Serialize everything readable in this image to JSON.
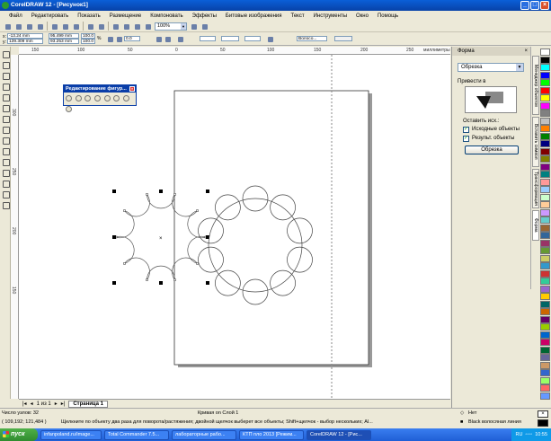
{
  "window": {
    "title": "CorelDRAW 12 - [Рисунок1]"
  },
  "menu": [
    "Файл",
    "Редактировать",
    "Показать",
    "Размещение",
    "Компоновать",
    "Эффекты",
    "Битовые изображения",
    "Текст",
    "Инструменты",
    "Окно",
    "Помощь"
  ],
  "toolbar": {
    "zoom": "100%",
    "line_width": "Волосо..."
  },
  "propbar": {
    "x": "-13.24 mm",
    "y": "139.309 mm",
    "w": "95.499 mm",
    "h": "93.253 mm",
    "sx": "100.0",
    "sy": "100.0",
    "angle": "0.0"
  },
  "rulers": {
    "h_labels": [
      "150",
      "100",
      "50",
      "0",
      "50",
      "100",
      "150",
      "200",
      "250"
    ],
    "h_unit": "миллиметры",
    "v_labels": [
      "300",
      "250",
      "200",
      "150"
    ]
  },
  "float_panel": {
    "title": "Редактирование фигур..."
  },
  "docker": {
    "title": "Форма",
    "mode": "Обрезка",
    "target_label": "Привести в",
    "leave_label": "Оставить исх.:",
    "opt1": "Исходные объекты",
    "opt2": "Результ. объекты",
    "button": "Обрезка"
  },
  "docker_tabs": [
    "Менеджер объектов",
    "Вставить символ",
    "Трансформация",
    "Форма"
  ],
  "palette_colors": [
    "#ffffff",
    "#000000",
    "#00ffff",
    "#0000ff",
    "#00ff00",
    "#ff0000",
    "#ffff00",
    "#ff00ff",
    "#808080",
    "#c0c0c0",
    "#ff8000",
    "#008000",
    "#000080",
    "#800000",
    "#808000",
    "#800080",
    "#008080",
    "#ff9999",
    "#99ccff",
    "#ccffcc",
    "#ffcc99",
    "#cc99ff",
    "#66cccc",
    "#996633",
    "#336699",
    "#993366",
    "#669933",
    "#cccc66",
    "#3399cc",
    "#cc3333",
    "#33cc99",
    "#9966cc",
    "#ffcc00",
    "#006666",
    "#cc6600",
    "#660066",
    "#99cc00",
    "#0066cc",
    "#cc0066",
    "#006633",
    "#666699",
    "#cc9966",
    "#3366cc",
    "#99ff66",
    "#ff6666",
    "#6699ff"
  ],
  "pagebar": {
    "count": "1 из 1",
    "page": "Страница 1"
  },
  "status": {
    "nodes": "Число узлов: 32",
    "curve": "Кривая on Слой 1",
    "coords": "( 109,192; 121,484 )",
    "hint": "Щелкните по объекту два раза для поворота/растяжения; двойной щелчок выберет все объекты; Shift+щелчок - выбор нескольких; Al...",
    "fill": "Нет",
    "outline": "Black  волосяная линия"
  },
  "taskbar": {
    "start": "пуск",
    "tasks": [
      "infanpoland.ru/image...",
      "Total Commander 7.5...",
      "лабораторные рабо...",
      "КТП пло 2013 [Режим...",
      "CorelDRAW 12 - [Рис..."
    ],
    "lang": "RU",
    "time": "10:55"
  }
}
